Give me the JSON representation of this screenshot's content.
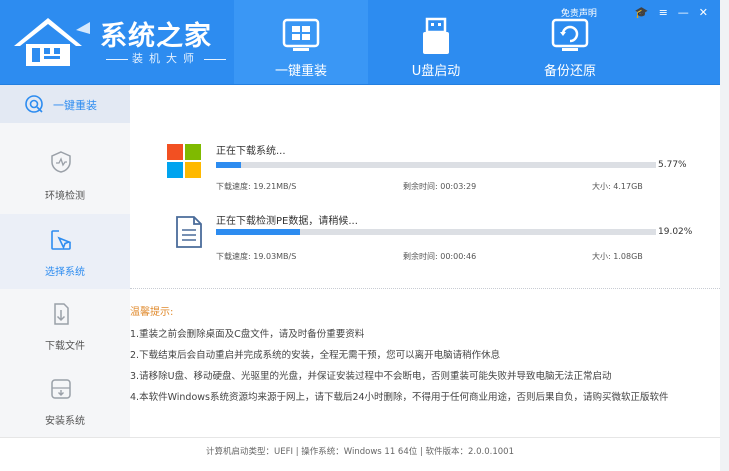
{
  "header": {
    "brand_title": "系统之家",
    "brand_sub": "装机大师",
    "tabs": [
      {
        "label": "一键重装",
        "icon": "windows-install-icon"
      },
      {
        "label": "U盘启动",
        "icon": "usb-drive-icon"
      },
      {
        "label": "备份还原",
        "icon": "backup-restore-icon"
      }
    ],
    "disclaimer": "免责声明"
  },
  "sidebar": {
    "top_label": "一键重装",
    "items": [
      {
        "label": "环境检测",
        "icon": "shield-check-icon"
      },
      {
        "label": "选择系统",
        "icon": "cursor-select-icon"
      },
      {
        "label": "下载文件",
        "icon": "download-file-icon"
      },
      {
        "label": "安装系统",
        "icon": "install-system-icon"
      }
    ]
  },
  "downloads": [
    {
      "title": "正在下载系统...",
      "progress_pct": 5.77,
      "percent_text": "5.77%",
      "speed_label": "下载速度:",
      "speed": "19.21MB/S",
      "remaining_label": "剩余时间:",
      "remaining": "00:03:29",
      "size_label": "大小:",
      "size": "4.17GB"
    },
    {
      "title": "正在下载检测PE数据，请稍候...",
      "progress_pct": 19.02,
      "percent_text": "19.02%",
      "speed_label": "下载速度:",
      "speed": "19.03MB/S",
      "remaining_label": "剩余时间:",
      "remaining": "00:00:46",
      "size_label": "大小:",
      "size": "1.08GB"
    }
  ],
  "tips": {
    "title": "温馨提示:",
    "lines": [
      "1.重装之前会删除桌面及C盘文件，请及时备份重要资料",
      "2.下载结束后会自动重启并完成系统的安装，全程无需干预，您可以离开电脑请稍作休息",
      "3.请移除U盘、移动硬盘、光驱里的光盘，并保证安装过程中不会断电，否则重装可能失败并导致电脑无法正常启动",
      "4.本软件Windows系统资源均来源于网上，请下载后24小时删除，不得用于任何商业用途，否则后果自负，请购买微软正版软件"
    ]
  },
  "footer": {
    "text": "计算机启动类型：UEFI | 操作系统：Windows 11 64位 | 软件版本：2.0.0.1001"
  },
  "colors": {
    "accent": "#2d8cf0",
    "tips_title": "#e08a2c",
    "sidebar_bg": "#f5f6f8"
  }
}
